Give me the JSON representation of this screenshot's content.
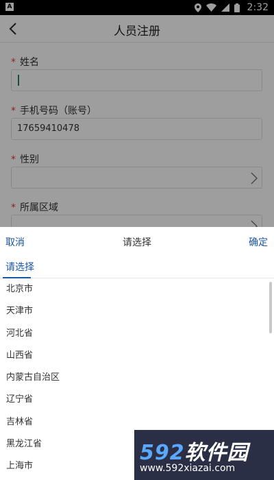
{
  "status_bar": {
    "app_icon_letter": "A",
    "time": "2:32"
  },
  "header": {
    "title": "人员注册"
  },
  "form": {
    "required_mark": "*",
    "fields": [
      {
        "label": "姓名",
        "value": ""
      },
      {
        "label": "手机号码（账号）",
        "value": "17659410478"
      },
      {
        "label": "性别",
        "value": ""
      },
      {
        "label": "所属区域",
        "value": ""
      }
    ]
  },
  "picker": {
    "cancel_label": "取消",
    "title": "请选择",
    "confirm_label": "确定",
    "tab_label": "请选择",
    "items": [
      "北京市",
      "天津市",
      "河北省",
      "山西省",
      "内蒙古自治区",
      "辽宁省",
      "吉林省",
      "黑龙江省",
      "上海市"
    ]
  },
  "watermark": {
    "brand_num": "592",
    "brand_text": "软件园",
    "url": "www.592xiazai.com"
  }
}
